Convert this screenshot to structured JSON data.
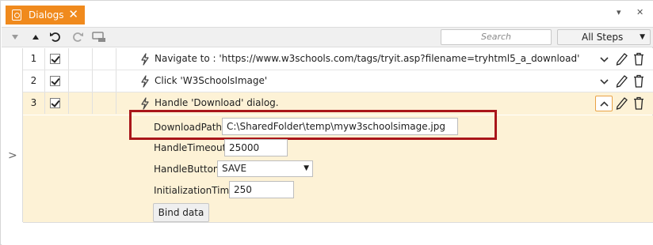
{
  "tab": {
    "title": "Dialogs",
    "close": "✕"
  },
  "window_controls": {
    "menu": "▾",
    "close": "✕"
  },
  "toolbar": {
    "search_placeholder": "Search",
    "steps_filter": "All Steps"
  },
  "steps": [
    {
      "number": "1",
      "text": "Navigate to : 'https://www.w3schools.com/tags/tryit.asp?filename=tryhtml5_a_download'",
      "checked": true,
      "expanded": false
    },
    {
      "number": "2",
      "text": "Click 'W3SchoolsImage'",
      "checked": true,
      "expanded": false
    },
    {
      "number": "3",
      "text": "Handle 'Download' dialog.",
      "checked": true,
      "expanded": true
    }
  ],
  "detail": {
    "download_path_label": "DownloadPath:",
    "download_path_value": "C:\\SharedFolder\\temp\\myw3schoolsimage.jpg",
    "handle_timeout_label": "HandleTimeout:",
    "handle_timeout_value": "25000",
    "handle_button_label": "HandleButton:",
    "handle_button_value": "SAVE",
    "initialization_time_label": "InitializationTime:",
    "initialization_time_value": "250",
    "bind_button": "Bind data"
  },
  "colors": {
    "accent": "#f08a1d",
    "active_row": "#fdf2d6",
    "highlight": "#a9161a"
  }
}
